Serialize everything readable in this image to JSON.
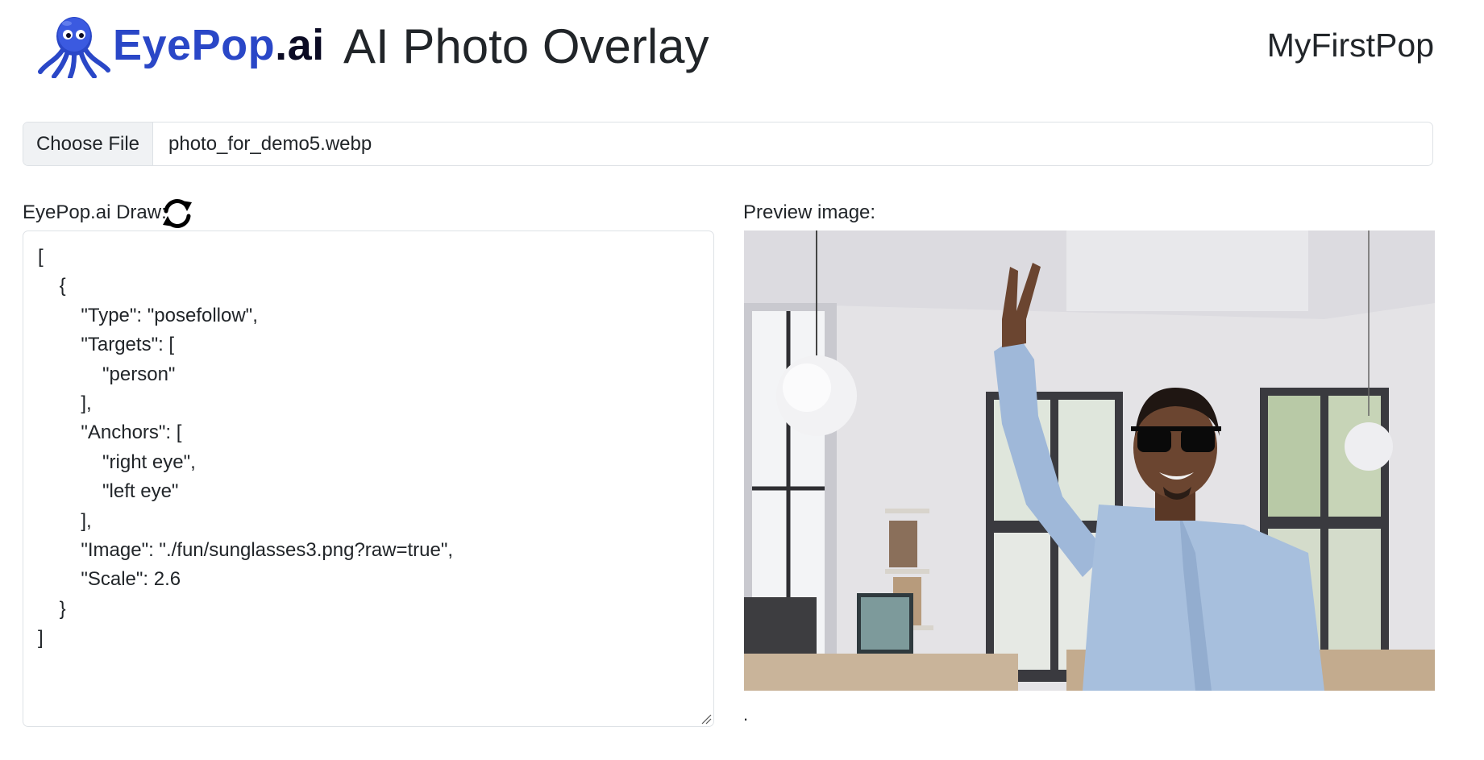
{
  "header": {
    "brand_main": "EyePop",
    "brand_tld": ".ai",
    "title": "AI Photo Overlay",
    "app_name": "MyFirstPop",
    "logo_icon": "octopus-logo-icon"
  },
  "file_input": {
    "button_label": "Choose File",
    "file_name": "photo_for_demo5.webp"
  },
  "draw_panel": {
    "label": "EyePop.ai Draw:",
    "refresh_icon": "refresh-icon",
    "content": "[\n    {\n        \"Type\": \"posefollow\",\n        \"Targets\": [\n            \"person\"\n        ],\n        \"Anchors\": [\n            \"right eye\",\n            \"left eye\"\n        ],\n        \"Image\": \"./fun/sunglasses3.png?raw=true\",\n        \"Scale\": 2.6\n    }\n]"
  },
  "preview_panel": {
    "label": "Preview image:",
    "caption": "."
  },
  "colors": {
    "brand_blue": "#2a47c7",
    "brand_dark": "#0b0b24",
    "text": "#212529",
    "border": "#dee2e6",
    "button_bg": "#f0f2f4"
  }
}
